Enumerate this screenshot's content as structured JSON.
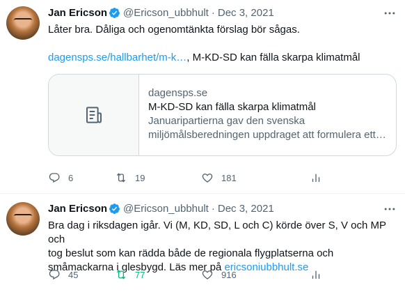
{
  "tweets": [
    {
      "author_name": "Jan Ericson",
      "handle": "@Ericson_ubbhult",
      "separator": "·",
      "date": "Dec 3, 2021",
      "text_line1": "Låter bra. Dåliga och ogenomtänkta förslag bör sågas.",
      "link": "dagensps.se/hallbarhet/m-k…",
      "text_after_link": ", M-KD-SD kan fälla skarpa klimatmål",
      "card": {
        "domain": "dagensps.se",
        "title": "M-KD-SD kan fälla skarpa klimatmål",
        "desc_line1": "Januaripartierna gav den svenska",
        "desc_line2": "miljömålsberedningen uppdraget att formulera ett …"
      },
      "replies": "6",
      "retweets": "19",
      "likes": "181"
    },
    {
      "author_name": "Jan Ericson",
      "handle": "@Ericson_ubbhult",
      "separator": "·",
      "date": "Dec 3, 2021",
      "text_line1": "Bra dag i riksdagen igår. Vi (M, KD, SD, L och C) körde över S, V och MP och",
      "text_line2": "tog beslut som kan rädda både de regionala flygplatserna och",
      "text_line3": "småmackarna i glesbygd. Läs mer på ",
      "link": "ericsoniubbhult.se",
      "replies": "45",
      "retweets": "77",
      "likes": "916"
    }
  ],
  "colors": {
    "link": "#1d9bf0",
    "verified": "#1d9bf0",
    "muted": "#536471",
    "retweet_active": "#00ba7c"
  },
  "icons": [
    "verified-badge-icon",
    "more-icon",
    "reply-icon",
    "retweet-icon",
    "like-icon",
    "analytics-icon",
    "article-icon"
  ]
}
